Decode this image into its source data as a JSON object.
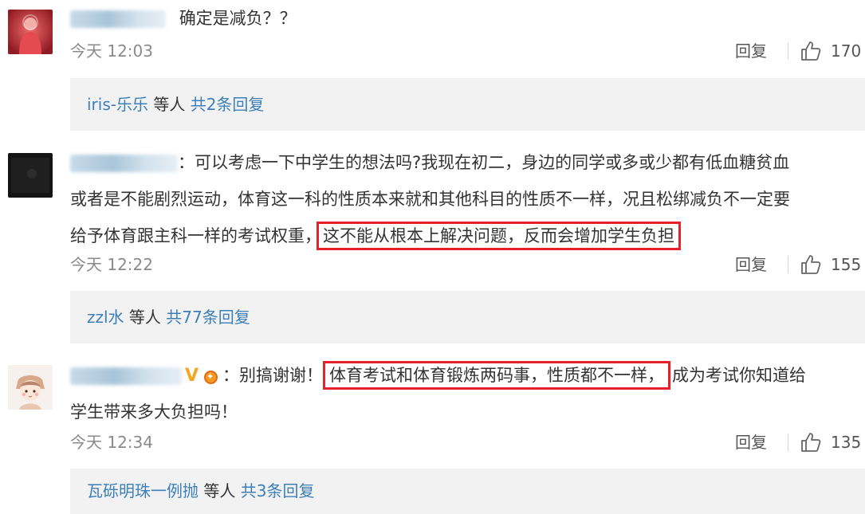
{
  "comments": [
    {
      "text": "确定是减负？？",
      "time": "今天 12:03",
      "reply_label": "回复",
      "likes": "170",
      "sub": {
        "who": "iris-乐乐",
        "etc": "等人",
        "total": "共2条回复"
      }
    },
    {
      "line1": "：可以考虑一下中学生的想法吗?我现在初二，身边的同学或多或少都有低血糖贫血",
      "line2": "或者是不能剧烈运动，体育这一科的性质本来就和其他科目的性质不一样，况且松绑减负不一定要",
      "line3_pre": "给予体育跟主科一样的考试权重，",
      "line3_hl": "这不能从根本上解决问题，反而会增加学生负担",
      "time": "今天 12:22",
      "reply_label": "回复",
      "likes": "155",
      "sub": {
        "who": "zzl水",
        "etc": "等人",
        "total": "共77条回复"
      }
    },
    {
      "badge": "V",
      "line1_pre": "：别搞谢谢！",
      "line1_hl": "体育考试和体育锻炼两码事，性质都不一样，",
      "line1_post": "成为考试你知道给",
      "line2": "学生带来多大负担吗！",
      "time": "今天 12:34",
      "reply_label": "回复",
      "likes": "135",
      "sub": {
        "who": "瓦砾明珠一例抛",
        "etc": "等人",
        "total": "共3条回复"
      }
    }
  ],
  "colors": {
    "link": "#3d7fb8",
    "highlight_box": "#e8202a",
    "meta": "#8a8a8a",
    "subbox_bg": "#f2f2f2"
  },
  "icons": [
    "avatar-red-figure",
    "avatar-dark",
    "avatar-cartoon-girl",
    "thumbs-up-icon",
    "v-badge-icon",
    "medal-icon"
  ]
}
